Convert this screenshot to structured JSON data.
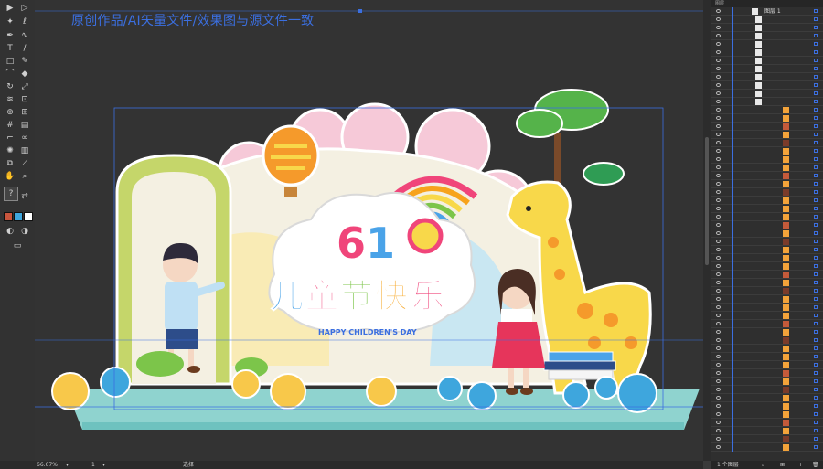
{
  "document": {
    "banner_text": "原创作品/AI矢量文件/效果图与源文件一致"
  },
  "toolbar": {
    "tools": [
      "selection-tool",
      "direct-selection-tool",
      "magic-wand-tool",
      "lasso-tool",
      "pen-tool",
      "curvature-tool",
      "type-tool",
      "line-tool",
      "rectangle-tool",
      "paintbrush-tool",
      "shaper-tool",
      "eraser-tool",
      "rotate-tool",
      "scale-tool",
      "width-tool",
      "free-transform-tool",
      "shape-builder-tool",
      "perspective-grid-tool",
      "mesh-tool",
      "gradient-tool",
      "eyedropper-tool",
      "blend-tool",
      "symbol-sprayer-tool",
      "column-graph-tool",
      "artboard-tool",
      "slice-tool",
      "hand-tool",
      "zoom-tool"
    ]
  },
  "artwork": {
    "number_text": "61",
    "title_chars": [
      "儿",
      "童",
      "节",
      "快",
      "乐"
    ],
    "subtitle": "HAPPY CHILDREN'S DAY",
    "colors": {
      "floor_top": "#8fd3cf",
      "floor_side": "#6ec2bf",
      "arch": "#c5d66a",
      "cloud_pink": "#f6c9d8",
      "cloud_white": "#ffffff",
      "title_blue": "#4aa3e8",
      "title_pink": "#f0457a",
      "title_orange": "#f7a31c",
      "title_green": "#7cc54a",
      "giraffe": "#f8d84a",
      "tree": "#55b34a",
      "balloon_orange": "#f59a2b",
      "selection_blue": "#3b6fe0"
    }
  },
  "statusbar": {
    "zoom": "66.67%",
    "artboard_number": "1",
    "mode_label": "选择"
  },
  "layers_panel": {
    "header_label": "图层",
    "top_layer_name": "图层 1",
    "footer_count": "1 个图层"
  }
}
